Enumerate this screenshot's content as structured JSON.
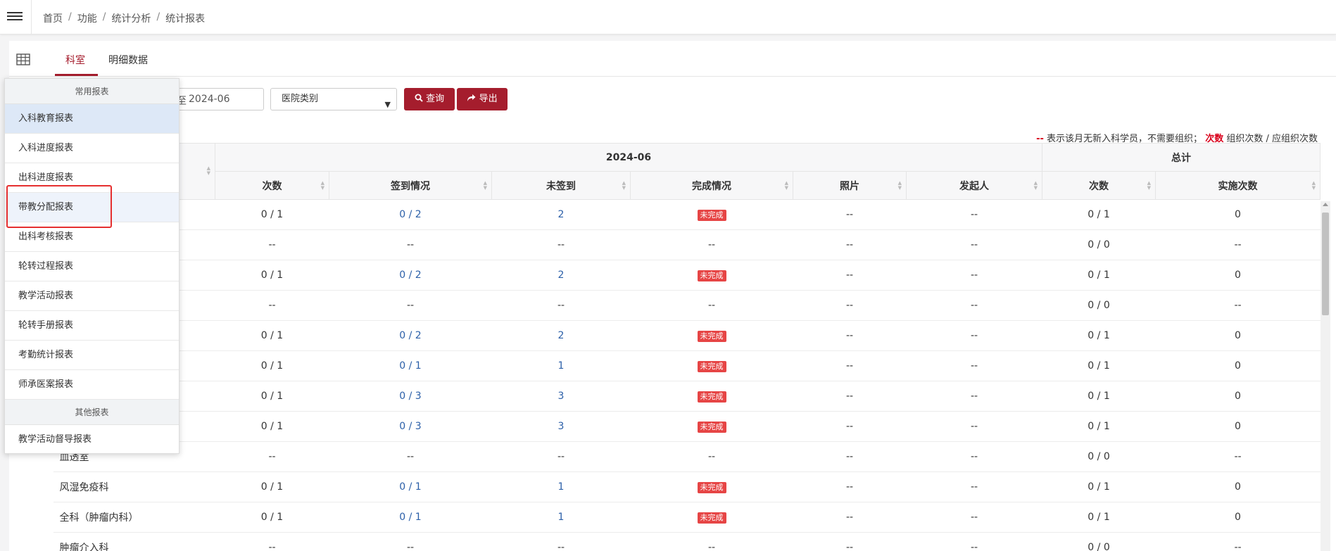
{
  "breadcrumb": [
    "首页",
    "功能",
    "统计分析",
    "统计报表"
  ],
  "tabs": [
    {
      "label": "科室"
    },
    {
      "label": "明细数据"
    }
  ],
  "filters": {
    "date_end_label": "至",
    "date_end": "2024-06",
    "hospital_select": "医院类别",
    "query_label": "查询",
    "export_label": "导出"
  },
  "legend": {
    "dash": "--",
    "dash_text": "表示该月无新入科学员，不需要组织；",
    "count_label": "次数",
    "count_text": "组织次数 / 应组织次数"
  },
  "table": {
    "month_header": "2024-06",
    "total_header": "总计",
    "columns": [
      "次数",
      "签到情况",
      "未签到",
      "完成情况",
      "照片",
      "发起人",
      "次数",
      "实施次数"
    ],
    "rows": [
      {
        "dept": "",
        "count": "0 / 1",
        "sign": "0 / 2",
        "unsigned": "2",
        "status": "未完成",
        "photo": "--",
        "initiator": "--",
        "total_count": "0 / 1",
        "impl": "0"
      },
      {
        "dept": "",
        "count": "--",
        "sign": "--",
        "unsigned": "--",
        "status": "--",
        "photo": "--",
        "initiator": "--",
        "total_count": "0 / 0",
        "impl": "--"
      },
      {
        "dept": "",
        "count": "0 / 1",
        "sign": "0 / 2",
        "unsigned": "2",
        "status": "未完成",
        "photo": "--",
        "initiator": "--",
        "total_count": "0 / 1",
        "impl": "0"
      },
      {
        "dept": "",
        "count": "--",
        "sign": "--",
        "unsigned": "--",
        "status": "--",
        "photo": "--",
        "initiator": "--",
        "total_count": "0 / 0",
        "impl": "--"
      },
      {
        "dept": "",
        "count": "0 / 1",
        "sign": "0 / 2",
        "unsigned": "2",
        "status": "未完成",
        "photo": "--",
        "initiator": "--",
        "total_count": "0 / 1",
        "impl": "0"
      },
      {
        "dept": "",
        "count": "0 / 1",
        "sign": "0 / 1",
        "unsigned": "1",
        "status": "未完成",
        "photo": "--",
        "initiator": "--",
        "total_count": "0 / 1",
        "impl": "0"
      },
      {
        "dept": "",
        "count": "0 / 1",
        "sign": "0 / 3",
        "unsigned": "3",
        "status": "未完成",
        "photo": "--",
        "initiator": "--",
        "total_count": "0 / 1",
        "impl": "0"
      },
      {
        "dept": "",
        "count": "0 / 1",
        "sign": "0 / 3",
        "unsigned": "3",
        "status": "未完成",
        "photo": "--",
        "initiator": "--",
        "total_count": "0 / 1",
        "impl": "0"
      },
      {
        "dept": "血透室",
        "count": "--",
        "sign": "--",
        "unsigned": "--",
        "status": "--",
        "photo": "--",
        "initiator": "--",
        "total_count": "0 / 0",
        "impl": "--"
      },
      {
        "dept": "风湿免疫科",
        "count": "0 / 1",
        "sign": "0 / 1",
        "unsigned": "1",
        "status": "未完成",
        "photo": "--",
        "initiator": "--",
        "total_count": "0 / 1",
        "impl": "0"
      },
      {
        "dept": "全科（肿瘤内科）",
        "count": "0 / 1",
        "sign": "0 / 1",
        "unsigned": "1",
        "status": "未完成",
        "photo": "--",
        "initiator": "--",
        "total_count": "0 / 1",
        "impl": "0"
      },
      {
        "dept": "肿瘤介入科",
        "count": "--",
        "sign": "--",
        "unsigned": "--",
        "status": "--",
        "photo": "--",
        "initiator": "--",
        "total_count": "0 / 0",
        "impl": "--"
      }
    ]
  },
  "dropdown": {
    "common_header": "常用报表",
    "common_items": [
      "入科教育报表",
      "入科进度报表",
      "出科进度报表",
      "带教分配报表",
      "出科考核报表",
      "轮转过程报表",
      "教学活动报表",
      "轮转手册报表",
      "考勤统计报表",
      "师承医案报表"
    ],
    "other_header": "其他报表",
    "other_items": [
      "教学活动督导报表"
    ]
  },
  "colors": {
    "accent": "#a51d2d",
    "badge": "#e64545",
    "link": "#2b5fa8",
    "highlight": "#e52f2f"
  }
}
